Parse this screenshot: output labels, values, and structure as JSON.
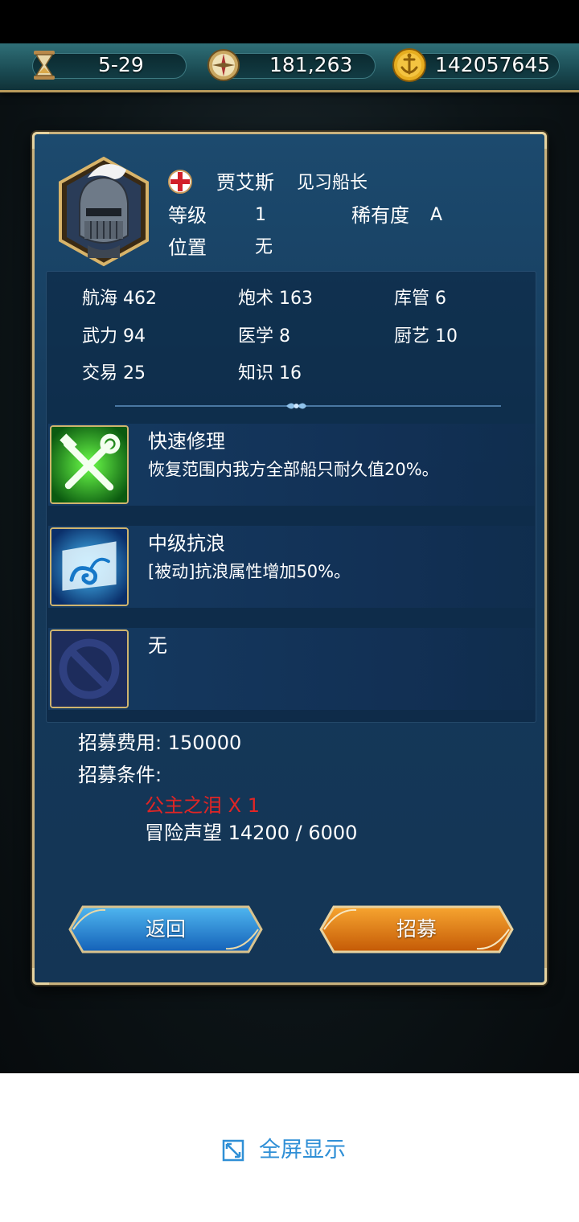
{
  "resources": {
    "date": "5-29",
    "compass_value": "181,263",
    "gold_value": "142057645"
  },
  "captain": {
    "name": "贾艾斯",
    "title": "见习船长",
    "level_label": "等级",
    "level": "1",
    "rarity_label": "稀有度",
    "rarity": "A",
    "position_label": "位置",
    "position": "无"
  },
  "stats": [
    {
      "label": "航海 462"
    },
    {
      "label": "炮术 163"
    },
    {
      "label": "库管 6"
    },
    {
      "label": "武力 94"
    },
    {
      "label": "医学 8"
    },
    {
      "label": "厨艺 10"
    },
    {
      "label": "交易 25"
    },
    {
      "label": "知识 16"
    }
  ],
  "skills": [
    {
      "name": "快速修理",
      "desc": "恢复范围内我方全部船只耐久值20%。",
      "icon": "repair-icon"
    },
    {
      "name": "中级抗浪",
      "desc": "[被动]抗浪属性增加50%。",
      "icon": "wave-icon"
    },
    {
      "name": "无",
      "desc": "",
      "icon": "empty-slot-icon"
    }
  ],
  "recruit": {
    "cost": "招募费用: 150000",
    "cond_label": "招募条件:",
    "item_req": "公主之泪 X 1",
    "fame_req": "冒险声望 14200 / 6000"
  },
  "buttons": {
    "back": "返回",
    "recruit": "招募"
  },
  "footer": {
    "fullscreen": "全屏显示"
  },
  "colors": {
    "required_red": "#e02525",
    "link_blue": "#2f8fd6"
  }
}
